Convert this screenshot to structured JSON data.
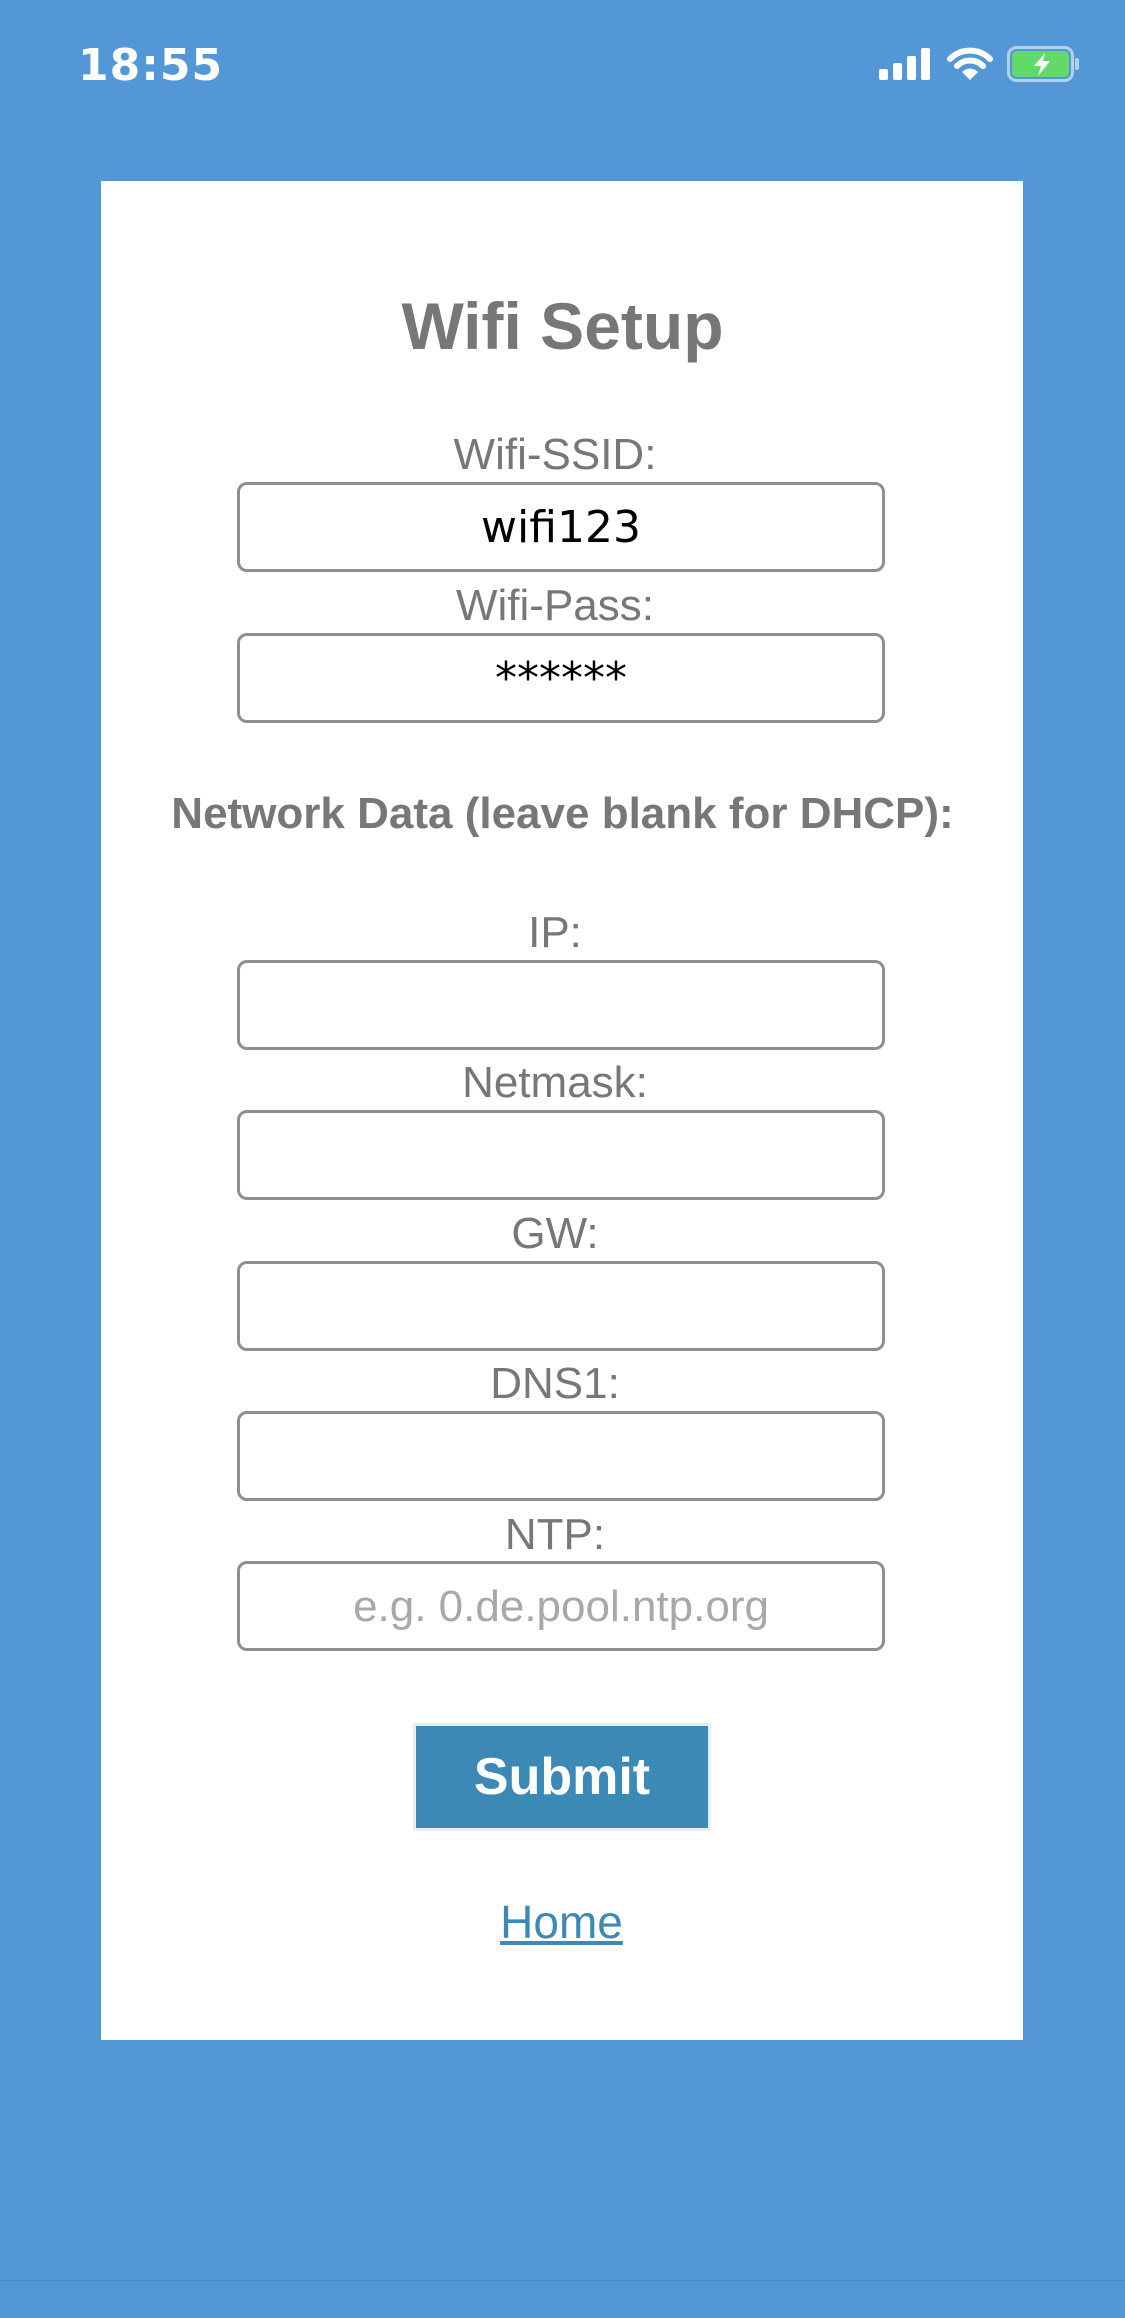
{
  "status_bar": {
    "time": "18:55",
    "icons": [
      "cellular-signal-icon",
      "wifi-icon",
      "battery-charging-icon"
    ]
  },
  "form": {
    "title": "Wifi Setup",
    "ssid_label": "Wifi-SSID:",
    "ssid_value": "wifi123",
    "pass_label": "Wifi-Pass:",
    "pass_value": "******",
    "network_heading": "Network Data (leave blank for DHCP):",
    "ip_label": "IP:",
    "ip_value": "",
    "netmask_label": "Netmask:",
    "netmask_value": "",
    "gw_label": "GW:",
    "gw_value": "",
    "dns1_label": "DNS1:",
    "dns1_value": "",
    "ntp_label": "NTP:",
    "ntp_placeholder": "e.g. 0.de.pool.ntp.org",
    "submit_label": "Submit",
    "home_link": "Home"
  },
  "colors": {
    "background": "#5497d6",
    "card": "#ffffff",
    "text_gray": "#777777",
    "accent": "#3c89b6",
    "battery": "#63d96a"
  }
}
